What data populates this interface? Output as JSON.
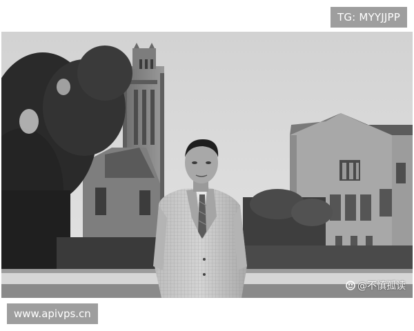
{
  "overlays": {
    "top_tag": "TG: MYYJJPP",
    "bottom_tag": "www.apivps.cn",
    "watermark": "@不慎孤读",
    "watermark_icon": "platform-logo-icon"
  },
  "photo": {
    "subject": "portrait-photo",
    "palette": {
      "sky": "#d6d6d6",
      "tree": "#2b2b2b",
      "stone": "#8f8f8f",
      "lawn": "#6e6e6e",
      "path": "#d8d8d8"
    }
  }
}
